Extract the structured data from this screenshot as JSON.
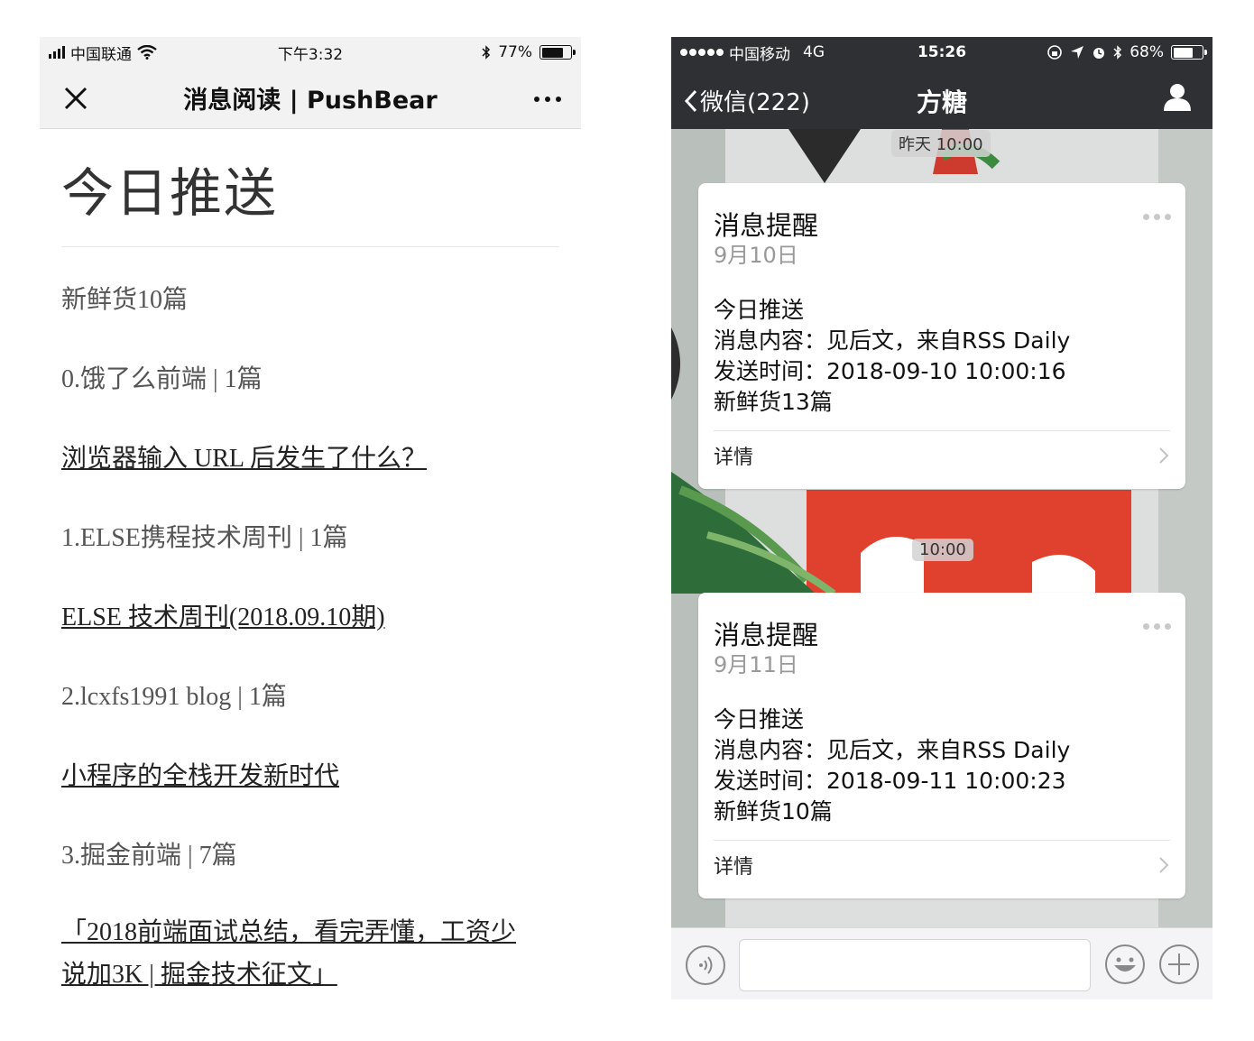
{
  "left": {
    "status": {
      "carrier": "中国联通",
      "time": "下午3:32",
      "battery": "77%",
      "battery_level": 0.77
    },
    "nav": {
      "title": "消息阅读 | PushBear"
    },
    "heading": "今日推送",
    "summary": "新鲜货10篇",
    "sections": [
      {
        "label": "0.饿了么前端 | 1篇",
        "links": [
          "浏览器输入 URL 后发生了什么？"
        ]
      },
      {
        "label": "1.ELSE携程技术周刊 | 1篇",
        "links": [
          "ELSE 技术周刊(2018.09.10期)"
        ]
      },
      {
        "label": "2.lcxfs1991 blog | 1篇",
        "links": [
          "小程序的全栈开发新时代"
        ]
      },
      {
        "label": "3.掘金前端 | 7篇",
        "links": [
          "「2018前端面试总结，看完弄懂，工资少说加3K | 掘金技术征文」"
        ]
      }
    ],
    "last_link_lines": [
      "「2018前端面试总结，看完弄懂，工资少",
      "说加3K | 掘金技术征文」"
    ]
  },
  "right": {
    "status": {
      "carrier": "中国移动",
      "network": "4G",
      "time": "15:26",
      "battery": "68%",
      "battery_level": 0.68
    },
    "nav": {
      "back": "微信(222)",
      "title": "方糖"
    },
    "messages": [
      {
        "time": "昨天 10:00",
        "title": "消息提醒",
        "date": "9月10日",
        "lines": [
          "今日推送",
          "消息内容：见后文，来自RSS Daily",
          "发送时间：2018-09-10 10:00:16",
          "新鲜货13篇"
        ],
        "detail": "详情"
      },
      {
        "time": "10:00",
        "title": "消息提醒",
        "date": "9月11日",
        "lines": [
          "今日推送",
          "消息内容：见后文，来自RSS Daily",
          "发送时间：2018-09-11 10:00:23",
          "新鲜货10篇"
        ],
        "detail": "详情"
      }
    ]
  },
  "colors": {
    "wechat_bar": "#2f3033",
    "page_bg": "#ffffff",
    "link": "#222222"
  }
}
